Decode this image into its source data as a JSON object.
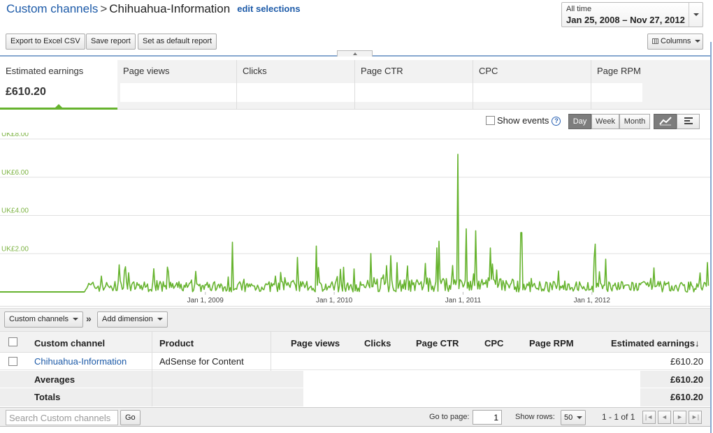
{
  "header": {
    "breadcrumb_root": "Custom channels",
    "breadcrumb_sep": ">",
    "breadcrumb_current": "Chihuahua-Information",
    "edit_selections": "edit selections",
    "date_label": "All time",
    "date_range": "Jan 25, 2008 – Nov 27, 2012"
  },
  "toolbar": {
    "export": "Export to Excel CSV",
    "save": "Save report",
    "set_default": "Set as default report",
    "columns": "Columns"
  },
  "metric_tabs": [
    {
      "label": "Estimated earnings",
      "value": "£610.20"
    },
    {
      "label": "Page views",
      "value": ""
    },
    {
      "label": "Clicks",
      "value": ""
    },
    {
      "label": "Page CTR",
      "value": ""
    },
    {
      "label": "CPC",
      "value": ""
    },
    {
      "label": "Page RPM",
      "value": ""
    }
  ],
  "chart_controls": {
    "show_events": "Show events",
    "help": "?",
    "granularity": [
      "Day",
      "Week",
      "Month"
    ],
    "selected_granularity": "Day",
    "chart_icon": "line-chart-icon",
    "table_icon": "list-view-icon"
  },
  "chart_data": {
    "type": "line",
    "series": [
      {
        "name": "",
        "color": "#66b32e"
      }
    ],
    "x_range": [
      "2008-01-25",
      "2012-11-27"
    ],
    "xtick_labels": [
      "Jan 1, 2009",
      "Jan 1, 2010",
      "Jan 1, 2011",
      "Jan 1, 2012"
    ],
    "ytick_labels": [
      "UK£2.00",
      "UK£4.00",
      "UK£6.00",
      "UK£8.00"
    ],
    "ylim": [
      0,
      8
    ],
    "grid": true,
    "spikes": [
      {
        "x": "2008-09-15",
        "y": 1.3
      },
      {
        "x": "2009-03-20",
        "y": 2.6
      },
      {
        "x": "2009-11-10",
        "y": 2.4
      },
      {
        "x": "2010-06-10",
        "y": 1.9
      },
      {
        "x": "2010-12-18",
        "y": 7.2
      },
      {
        "x": "2011-01-10",
        "y": 3.3
      },
      {
        "x": "2011-02-05",
        "y": 3.2
      },
      {
        "x": "2011-03-20",
        "y": 2.3
      },
      {
        "x": "2011-06-15",
        "y": 3.1
      },
      {
        "x": "2012-01-10",
        "y": 2.5
      }
    ]
  },
  "dimension_bar": {
    "dimension": "Custom channels",
    "separator": "»",
    "add_dimension": "Add dimension"
  },
  "table": {
    "headers": [
      "Custom channel",
      "Product",
      "Page views",
      "Clicks",
      "Page CTR",
      "CPC",
      "Page RPM",
      "Estimated earnings"
    ],
    "sort_arrow": "↓",
    "rows": [
      {
        "channel": "Chihuahua-Information",
        "product": "AdSense for Content",
        "earnings": "£610.20"
      }
    ],
    "averages_label": "Averages",
    "averages_earnings": "£610.20",
    "totals_label": "Totals",
    "totals_earnings": "£610.20"
  },
  "footer": {
    "search_placeholder": "Search Custom channels",
    "go": "Go",
    "goto_label": "Go to page:",
    "page": "1",
    "show_rows_label": "Show rows:",
    "rows_value": "50",
    "range": "1 - 1 of 1",
    "first": "|◄",
    "prev": "◄",
    "next": "►",
    "last": "►|"
  }
}
